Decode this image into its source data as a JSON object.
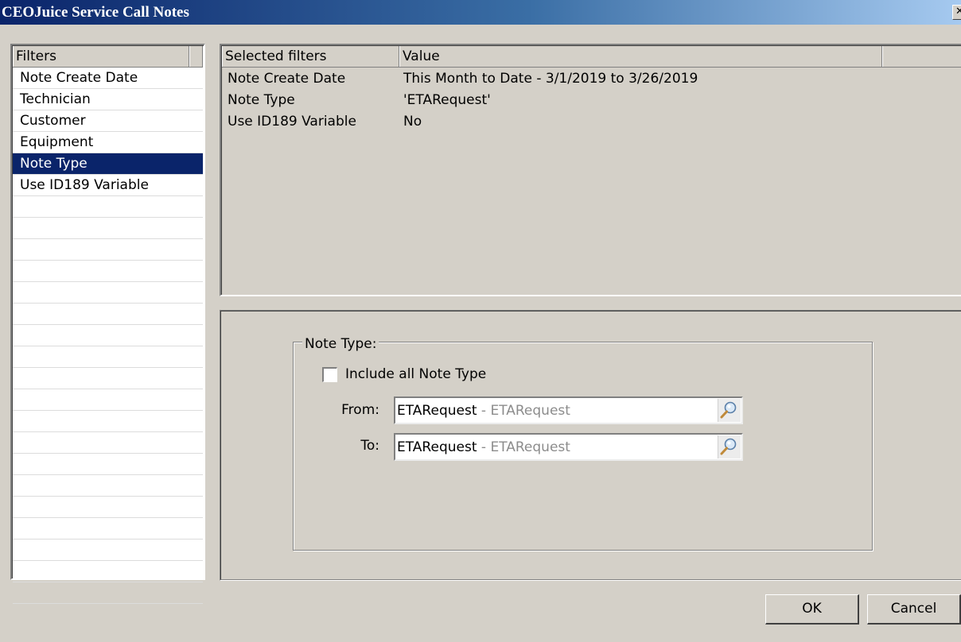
{
  "window": {
    "title": "CEOJuice Service Call Notes"
  },
  "filters_list": {
    "header": "Filters",
    "items": [
      {
        "label": "Note Create Date",
        "selected": false
      },
      {
        "label": "Technician",
        "selected": false
      },
      {
        "label": "Customer",
        "selected": false
      },
      {
        "label": "Equipment",
        "selected": false
      },
      {
        "label": "Note Type",
        "selected": true
      },
      {
        "label": "Use ID189 Variable",
        "selected": false
      }
    ]
  },
  "selected_filters": {
    "header_name": "Selected filters",
    "header_value": "Value",
    "rows": [
      {
        "name": "Note Create Date",
        "value": "This Month to Date - 3/1/2019 to 3/26/2019"
      },
      {
        "name": "Note Type",
        "value": "'ETARequest'"
      },
      {
        "name": "Use ID189 Variable",
        "value": "No"
      }
    ]
  },
  "note_type_panel": {
    "group_label": "Note Type:",
    "include_all_label": "Include all Note Type",
    "include_all_checked": false,
    "from_label": "From:",
    "from_value": "ETARequest",
    "from_separator": " - ",
    "from_description": "ETARequest",
    "to_label": "To:",
    "to_value": "ETARequest",
    "to_separator": " - ",
    "to_description": "ETARequest"
  },
  "buttons": {
    "ok": "OK",
    "cancel": "Cancel"
  },
  "icons": {
    "lookup": "magnifier-icon",
    "close": "close-icon"
  }
}
